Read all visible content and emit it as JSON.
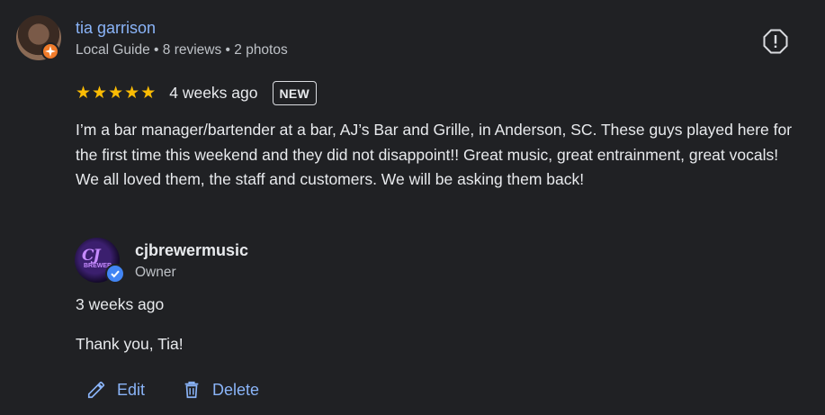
{
  "reviewer": {
    "name": "tia garrison",
    "meta": "Local Guide • 8 reviews • 2 photos"
  },
  "rating": {
    "stars": 5,
    "time": "4 weeks ago",
    "badge": "NEW"
  },
  "review_text": "I’m a bar manager/bartender at a bar, AJ’s Bar and Grille, in Anderson, SC. These guys played here for the first time this weekend and they did not disappoint!! Great music, great entrainment, great vocals! We all loved them, the staff and customers. We will be asking them back!",
  "owner": {
    "name": "cjbrewermusic",
    "role": "Owner",
    "logo_text": "CJ",
    "logo_subtext": "BREWER"
  },
  "reply": {
    "time": "3 weeks ago",
    "text": "Thank you, Tia!"
  },
  "actions": {
    "edit": "Edit",
    "delete": "Delete"
  },
  "icons": {
    "report": "report-icon",
    "edit": "pencil-icon",
    "delete": "trash-icon",
    "verified": "verified-check-icon",
    "guide": "local-guide-icon"
  },
  "colors": {
    "background": "#202124",
    "link": "#8ab4f8",
    "star": "#fbbc04",
    "guide_badge": "#f07b2a",
    "verified": "#4285f4"
  }
}
